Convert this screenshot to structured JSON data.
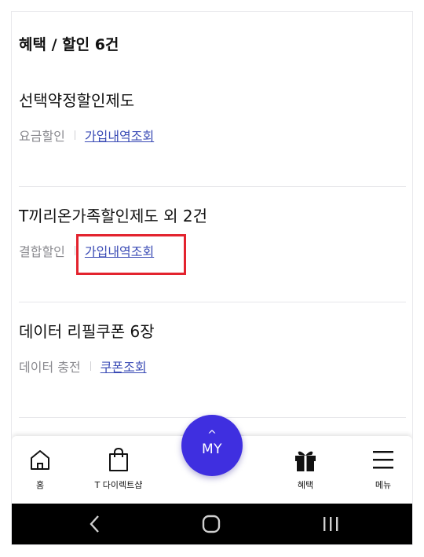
{
  "section": {
    "title": "혜택 / 할인 6건"
  },
  "benefits": [
    {
      "title": "선택약정할인제도",
      "category": "요금할인",
      "link": "가입내역조회"
    },
    {
      "title": "T끼리온가족할인제도 외 2건",
      "category": "결합할인",
      "link": "가입내역조회"
    },
    {
      "title": "데이터 리필쿠폰 6장",
      "category": "데이터 충전",
      "link": "쿠폰조회"
    }
  ],
  "bottom_nav": {
    "home": {
      "label": "홈",
      "icon": "home-icon"
    },
    "shop": {
      "label": "T 다이렉트샵",
      "icon": "shopping-bag-icon"
    },
    "my": {
      "label": "MY",
      "caret": "^",
      "icon": "chevron-up-icon"
    },
    "benefits": {
      "label": "혜택",
      "icon": "gift-icon"
    },
    "menu": {
      "label": "메뉴",
      "icon": "hamburger-menu-icon"
    }
  },
  "colors": {
    "accent": "#3f2fe0",
    "link": "#3a4bb5",
    "highlight": "#e3232e"
  }
}
